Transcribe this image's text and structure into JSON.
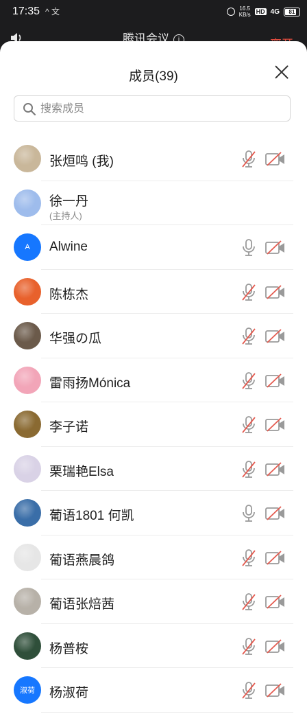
{
  "status_bar": {
    "time": "17:35",
    "left_icons": "^ 文",
    "speed_value": "16.5",
    "speed_unit": "KB/s",
    "hd": "HD",
    "network": "4G",
    "battery": "81",
    "battery_level": 0.81
  },
  "meeting_bar": {
    "title": "腾讯会议",
    "leave_label": "离开"
  },
  "panel": {
    "title": "成员(39)",
    "search_placeholder": "搜索成员"
  },
  "colors": {
    "mic_on": "#9a9a9a",
    "muted_slash": "#e45a4f",
    "accent_blue": "#1677ff"
  },
  "members": [
    {
      "name": "张烜鸣 (我)",
      "sub": "",
      "avatar": "photo",
      "avatar_color": "#c9b79a",
      "mic": "muted",
      "cam": "off"
    },
    {
      "name": "徐一丹",
      "sub": "(主持人)",
      "avatar": "photo",
      "avatar_color": "#9ebcec",
      "mic": "none",
      "cam": "none"
    },
    {
      "name": "Alwine",
      "sub": "",
      "avatar": "letter",
      "avatar_text": "A",
      "avatar_color": "#1677ff",
      "mic": "on",
      "cam": "off"
    },
    {
      "name": "陈栋杰",
      "sub": "",
      "avatar": "photo",
      "avatar_color": "#e8612c",
      "mic": "muted",
      "cam": "off"
    },
    {
      "name": "华强の瓜",
      "sub": "",
      "avatar": "photo",
      "avatar_color": "#6b5a4a",
      "mic": "muted",
      "cam": "off"
    },
    {
      "name": "雷雨扬Mónica",
      "sub": "",
      "avatar": "photo",
      "avatar_color": "#f2a5b8",
      "mic": "muted",
      "cam": "off"
    },
    {
      "name": "李子诺",
      "sub": "",
      "avatar": "photo",
      "avatar_color": "#8a6a32",
      "mic": "muted",
      "cam": "off"
    },
    {
      "name": "栗瑞艳Elsa",
      "sub": "",
      "avatar": "photo",
      "avatar_color": "#d9d2e6",
      "mic": "muted",
      "cam": "off"
    },
    {
      "name": "葡语1801 何凯",
      "sub": "",
      "avatar": "photo",
      "avatar_color": "#3a6ea8",
      "mic": "on",
      "cam": "off"
    },
    {
      "name": "葡语燕晨鸽",
      "sub": "",
      "avatar": "photo",
      "avatar_color": "#e6e6e6",
      "mic": "muted",
      "cam": "off"
    },
    {
      "name": "葡语张焙茜",
      "sub": "",
      "avatar": "photo",
      "avatar_color": "#b7b1a8",
      "mic": "muted",
      "cam": "off"
    },
    {
      "name": "杨普桉",
      "sub": "",
      "avatar": "photo",
      "avatar_color": "#2f4f3a",
      "mic": "muted",
      "cam": "off"
    },
    {
      "name": "杨淑荷",
      "sub": "",
      "avatar": "letter",
      "avatar_text": "淑荷",
      "avatar_color": "#1677ff",
      "mic": "muted",
      "cam": "off"
    }
  ]
}
